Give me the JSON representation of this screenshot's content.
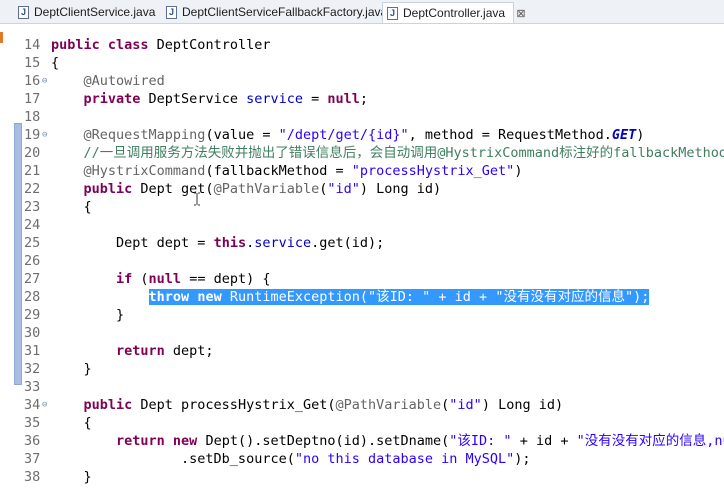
{
  "tabs": [
    {
      "label": "DeptClientService.java",
      "active": false
    },
    {
      "label": "DeptClientServiceFallbackFactory.java",
      "active": false
    },
    {
      "label": "DeptController.java",
      "active": true,
      "close": "⊠"
    }
  ],
  "lines": [
    {
      "n": "14",
      "parts": [
        [
          "kw",
          "public class "
        ],
        [
          "",
          "DeptController"
        ]
      ]
    },
    {
      "n": "15",
      "parts": [
        [
          "",
          "{"
        ]
      ]
    },
    {
      "n": "16",
      "fold": "⊖",
      "parts": [
        [
          "ann",
          "    @Autowired"
        ]
      ]
    },
    {
      "n": "17",
      "parts": [
        [
          "kw",
          "    private "
        ],
        [
          "",
          "DeptService "
        ],
        [
          "fld",
          "service"
        ],
        [
          "",
          " = "
        ],
        [
          "kw",
          "null"
        ],
        [
          "",
          ";"
        ]
      ]
    },
    {
      "n": "18",
      "parts": []
    },
    {
      "n": "19",
      "fold": "⊖",
      "parts": [
        [
          "ann",
          "    @RequestMapping"
        ],
        [
          "",
          "(value = "
        ],
        [
          "str",
          "\"/dept/get/{id}\""
        ],
        [
          "",
          ", method = RequestMethod."
        ],
        [
          "ital",
          "GET"
        ],
        [
          "",
          ")"
        ]
      ]
    },
    {
      "n": "20",
      "parts": [
        [
          "cmt",
          "    //一旦调用服务方法失败并抛出了错误信息后，会自动调用@HystrixCommand标注好的fallbackMethod调用"
        ]
      ]
    },
    {
      "n": "21",
      "parts": [
        [
          "ann",
          "    @HystrixCommand"
        ],
        [
          "",
          "(fallbackMethod = "
        ],
        [
          "str",
          "\"processHystrix_Get\""
        ],
        [
          "",
          ")"
        ]
      ]
    },
    {
      "n": "22",
      "parts": [
        [
          "kw",
          "    public "
        ],
        [
          "",
          "Dept get("
        ],
        [
          "ann",
          "@PathVariable"
        ],
        [
          "",
          "("
        ],
        [
          "str",
          "\"id\""
        ],
        [
          "",
          ") Long id)"
        ]
      ]
    },
    {
      "n": "23",
      "parts": [
        [
          "",
          "    {"
        ]
      ]
    },
    {
      "n": "24",
      "parts": []
    },
    {
      "n": "25",
      "parts": [
        [
          "",
          "        Dept dept = "
        ],
        [
          "kw",
          "this"
        ],
        [
          "",
          "."
        ],
        [
          "fld",
          "service"
        ],
        [
          "",
          ".get(id);"
        ]
      ]
    },
    {
      "n": "26",
      "parts": []
    },
    {
      "n": "27",
      "parts": [
        [
          "kw",
          "        if "
        ],
        [
          "",
          "("
        ],
        [
          "kw",
          "null"
        ],
        [
          "",
          " == dept) {"
        ]
      ]
    },
    {
      "n": "28",
      "sel": true,
      "lead": "            ",
      "parts": [
        [
          "kw",
          "throw new "
        ],
        [
          "",
          "RuntimeException("
        ],
        [
          "str",
          "\"该ID: \""
        ],
        [
          "",
          " + id + "
        ],
        [
          "str",
          "\"没有没有对应的信息\""
        ],
        [
          "",
          ");"
        ]
      ]
    },
    {
      "n": "29",
      "parts": [
        [
          "",
          "        }"
        ]
      ]
    },
    {
      "n": "30",
      "parts": []
    },
    {
      "n": "31",
      "parts": [
        [
          "kw",
          "        return "
        ],
        [
          "",
          "dept;"
        ]
      ]
    },
    {
      "n": "32",
      "parts": [
        [
          "",
          "    }"
        ]
      ]
    },
    {
      "n": "33",
      "parts": []
    },
    {
      "n": "34",
      "fold": "⊖",
      "parts": [
        [
          "kw",
          "    public "
        ],
        [
          "",
          "Dept processHystrix_Get("
        ],
        [
          "ann",
          "@PathVariable"
        ],
        [
          "",
          "("
        ],
        [
          "str",
          "\"id\""
        ],
        [
          "",
          ") Long id)"
        ]
      ]
    },
    {
      "n": "35",
      "parts": [
        [
          "",
          "    {"
        ]
      ]
    },
    {
      "n": "36",
      "parts": [
        [
          "kw",
          "        return new "
        ],
        [
          "",
          "Dept().setDeptno(id).setDname("
        ],
        [
          "str",
          "\"该ID: \""
        ],
        [
          "",
          " + id + "
        ],
        [
          "str",
          "\"没有没有对应的信息,nu"
        ]
      ]
    },
    {
      "n": "37",
      "parts": [
        [
          "",
          "                .setDb_source("
        ],
        [
          "str",
          "\"no this database in MySQL\""
        ],
        [
          "",
          ");"
        ]
      ]
    },
    {
      "n": "38",
      "parts": [
        [
          "",
          "    }"
        ]
      ]
    }
  ],
  "colors": {
    "keyword": "#7f0055",
    "annotation": "#646464",
    "string": "#2a00ff",
    "field": "#0000c0",
    "comment": "#3f7f5f",
    "selection": "#3399ff"
  }
}
